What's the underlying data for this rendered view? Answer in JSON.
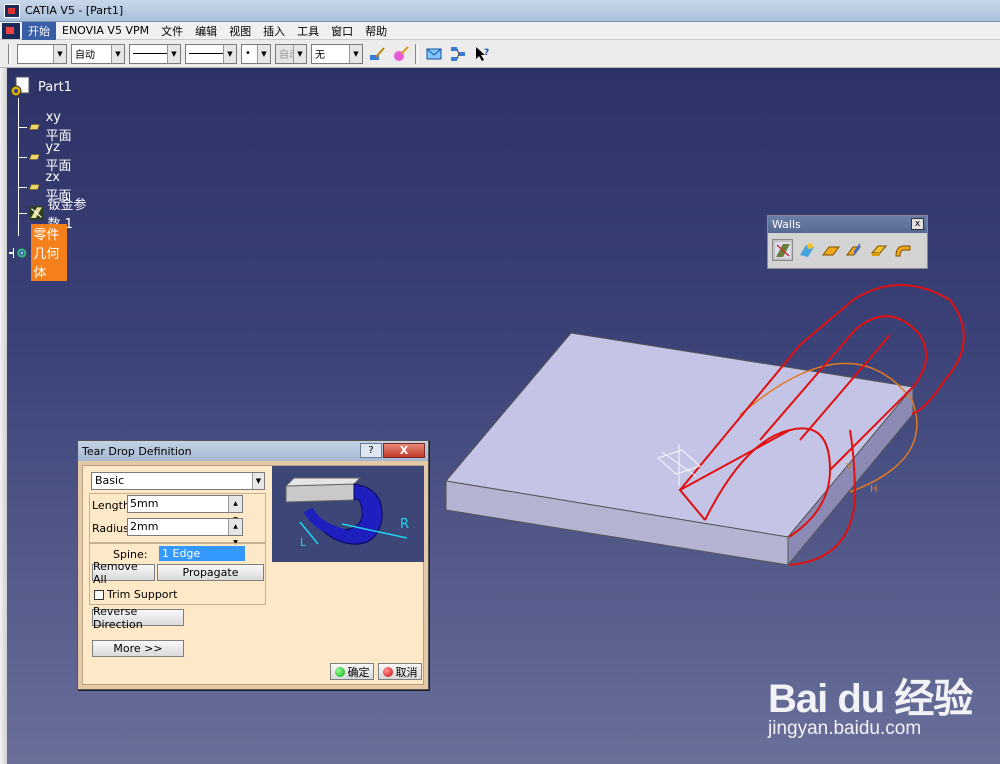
{
  "window": {
    "title": "CATIA V5 - [Part1]"
  },
  "menu": {
    "items": [
      "开始",
      "ENOVIA V5 VPM",
      "文件",
      "编辑",
      "视图",
      "插入",
      "工具",
      "窗口",
      "帮助"
    ]
  },
  "toolbar": {
    "color_value": "",
    "transparency_value": "自动",
    "linetype_value": "",
    "thickness_value": "",
    "point_value": "•",
    "layer_disabled_value": "自动",
    "layer_value": "无",
    "icons": [
      "paint-brush-icon",
      "painter-icon",
      "envelope-icon",
      "graph-icon",
      "pointer-help-icon"
    ]
  },
  "tree": {
    "root": "Part1",
    "nodes": [
      {
        "label": "xy 平面",
        "icon": "plane-icon"
      },
      {
        "label": "yz 平面",
        "icon": "plane-icon"
      },
      {
        "label": "zx 平面",
        "icon": "plane-icon"
      },
      {
        "label": "钣金参数.1",
        "icon": "sheetmetal-params-icon"
      },
      {
        "label": "零件几何体",
        "icon": "part-body-icon",
        "selected": true
      }
    ]
  },
  "walls_toolbar": {
    "title": "Walls",
    "close": "x",
    "buttons": [
      "sheet-metal-params-icon",
      "recognize-icon",
      "wall-icon",
      "wall-on-edge-icon",
      "extrusion-icon",
      "swept-wall-icon"
    ]
  },
  "dialog": {
    "title": "Tear Drop Definition",
    "help": "?",
    "close": "X",
    "mode": "Basic",
    "length_label": "Length:",
    "length_value": "5mm",
    "radius_label": "Radius:",
    "radius_value": "2mm",
    "spine_label": "Spine:",
    "spine_value": "1 Edge",
    "remove_all": "Remove All",
    "propagate": "Propagate",
    "trim_support": "Trim Support",
    "reverse_direction": "Reverse Direction",
    "more": "More >>",
    "ok": "确定",
    "cancel": "取消",
    "preview_labels": {
      "length": "L",
      "radius": "R"
    }
  },
  "watermark": {
    "logo": "Bai du 经验",
    "url": "jingyan.baidu.com"
  }
}
